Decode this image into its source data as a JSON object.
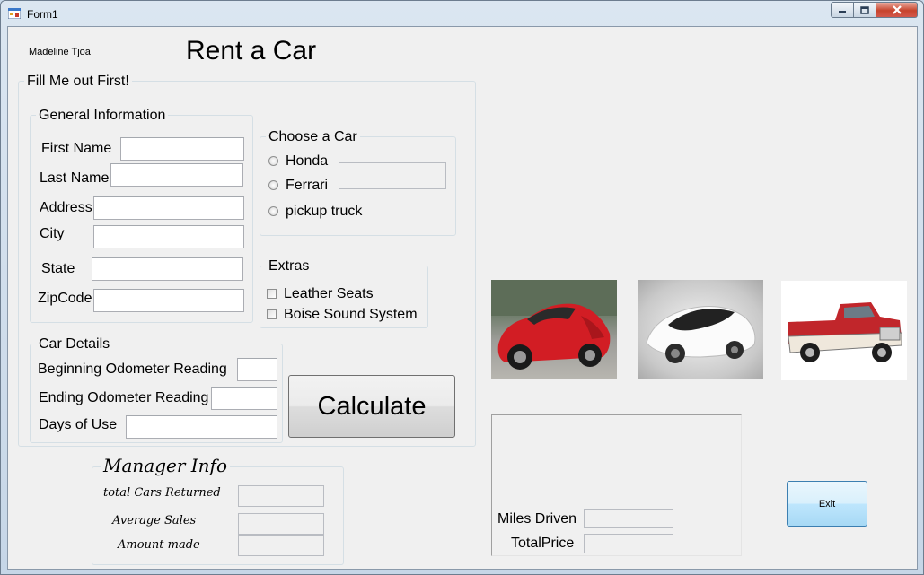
{
  "window": {
    "title": "Form1"
  },
  "author": "Madeline Tjoa",
  "heading": "Rent a Car",
  "main_group": {
    "title": "Fill Me out First!"
  },
  "general_info": {
    "title": "General Information",
    "first_name_label": "First Name",
    "last_name_label": "Last Name",
    "address_label": "Address",
    "city_label": "City",
    "state_label": "State",
    "zip_label": "ZipCode",
    "first_name_value": "",
    "last_name_value": "",
    "address_value": "",
    "city_value": "",
    "state_value": "",
    "zip_value": ""
  },
  "choose_car": {
    "title": "Choose a Car",
    "options": [
      "Honda",
      "Ferrari",
      "pickup truck"
    ],
    "display_value": ""
  },
  "extras": {
    "title": "Extras",
    "options": [
      "Leather Seats",
      "Boise Sound System"
    ]
  },
  "car_details": {
    "title": "Car Details",
    "begin_label": "Beginning Odometer Reading",
    "end_label": "Ending Odometer Reading",
    "days_label": "Days of Use",
    "begin_value": "",
    "end_value": "",
    "days_value": ""
  },
  "calculate_label": "Calculate",
  "manager": {
    "title": "Manager Info",
    "total_label": "total Cars Returned",
    "avg_label": "Average Sales",
    "amount_label": "Amount made",
    "total_value": "",
    "avg_value": "",
    "amount_value": ""
  },
  "results": {
    "miles_label": "Miles Driven",
    "price_label": "TotalPrice",
    "miles_value": "",
    "price_value": ""
  },
  "exit_label": "Exit",
  "icons": {
    "app": "form-app-icon",
    "minimize": "minimize-icon",
    "maximize": "maximize-icon",
    "close": "close-icon"
  },
  "colors": {
    "client_bg": "#f0f0f0",
    "close_btn": "#c7432c",
    "focus_border": "#3c7fb1"
  }
}
